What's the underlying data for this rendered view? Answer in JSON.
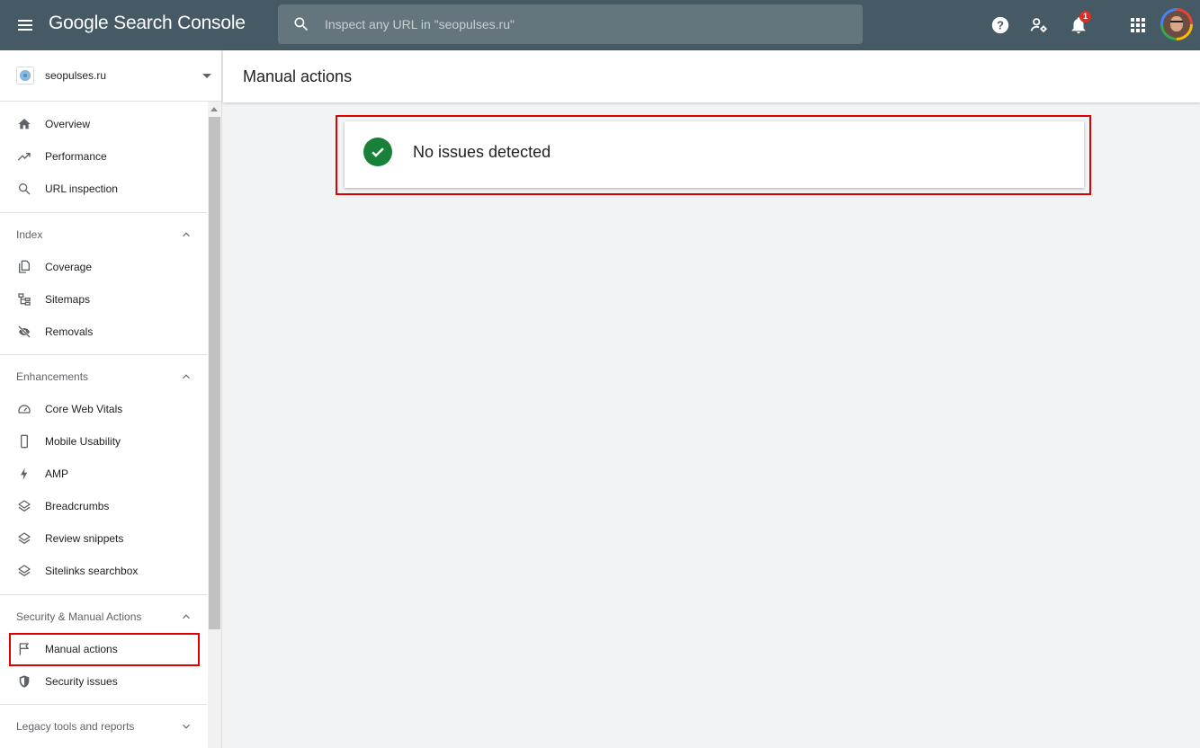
{
  "app": {
    "title": "Google Search Console",
    "search_placeholder": "Inspect any URL in \"seopulses.ru\"",
    "notification_count": "1"
  },
  "sidebar": {
    "property": "seopulses.ru",
    "top_items": [
      {
        "label": "Overview",
        "icon": "home-icon"
      },
      {
        "label": "Performance",
        "icon": "trending-up-icon"
      },
      {
        "label": "URL inspection",
        "icon": "search-icon"
      }
    ],
    "sections": [
      {
        "title": "Index",
        "expanded": true,
        "items": [
          {
            "label": "Coverage",
            "icon": "file-copy-icon"
          },
          {
            "label": "Sitemaps",
            "icon": "sitemap-icon"
          },
          {
            "label": "Removals",
            "icon": "visibility-off-icon"
          }
        ]
      },
      {
        "title": "Enhancements",
        "expanded": true,
        "items": [
          {
            "label": "Core Web Vitals",
            "icon": "speedometer-icon"
          },
          {
            "label": "Mobile Usability",
            "icon": "smartphone-icon"
          },
          {
            "label": "AMP",
            "icon": "bolt-icon"
          },
          {
            "label": "Breadcrumbs",
            "icon": "layers-icon"
          },
          {
            "label": "Review snippets",
            "icon": "layers-icon"
          },
          {
            "label": "Sitelinks searchbox",
            "icon": "layers-icon"
          }
        ]
      },
      {
        "title": "Security & Manual Actions",
        "expanded": true,
        "items": [
          {
            "label": "Manual actions",
            "icon": "flag-icon",
            "selected": true
          },
          {
            "label": "Security issues",
            "icon": "shield-icon"
          }
        ]
      },
      {
        "title": "Legacy tools and reports",
        "expanded": false,
        "items": []
      }
    ]
  },
  "main": {
    "page_title": "Manual actions",
    "status_message": "No issues detected"
  },
  "colors": {
    "topbar": "#455a64",
    "success": "#188038",
    "highlight": "#e00000",
    "badge": "#d93025"
  }
}
